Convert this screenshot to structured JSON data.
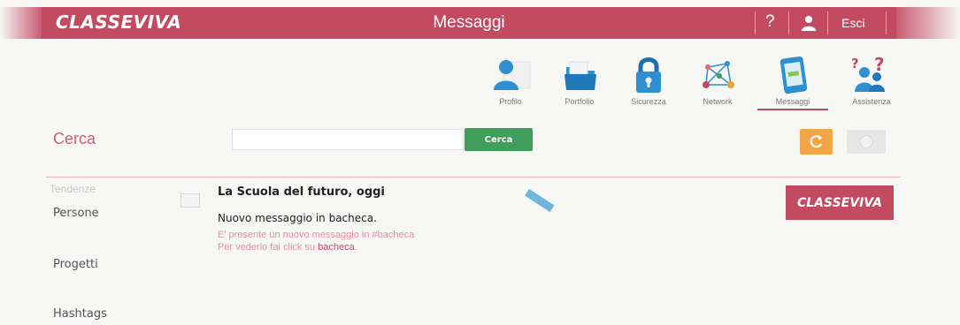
{
  "header": {
    "brand": "CLASSEVIVA",
    "title": "Messaggi",
    "help_label": "?",
    "user_icon": "user-icon",
    "logout_label": "Esci",
    "bar_color": "#c24b62"
  },
  "nav": {
    "items": [
      {
        "label": "Profilo",
        "icon": "profile-icon"
      },
      {
        "label": "Portfolio",
        "icon": "folder-icon"
      },
      {
        "label": "Sicurezza",
        "icon": "lock-icon"
      },
      {
        "label": "Network",
        "icon": "network-icon"
      },
      {
        "label": "Messaggi",
        "icon": "phone-icon",
        "active": true
      },
      {
        "label": "Assistenza",
        "icon": "help-people-icon"
      }
    ]
  },
  "search": {
    "heading": "Cerca",
    "placeholder": "",
    "button_label": "Cerca",
    "button_color": "#3f9e5a",
    "refresh_color": "#f3a648"
  },
  "sidebar": {
    "trends_label": "Tendenze",
    "items": [
      "Persone",
      "Progetti",
      "Hashtags"
    ]
  },
  "post": {
    "title": "La Scuola del futuro, oggi",
    "message_heading": "Nuovo messaggio in bacheca.",
    "line1": "E' presente un nuovo messaggio in #bacheca",
    "line2_prefix": "Per vederlo fai click su ",
    "line2_link": "bacheca",
    "line2_suffix": "."
  },
  "logo_card": {
    "brand": "CLASSEVIVA"
  }
}
